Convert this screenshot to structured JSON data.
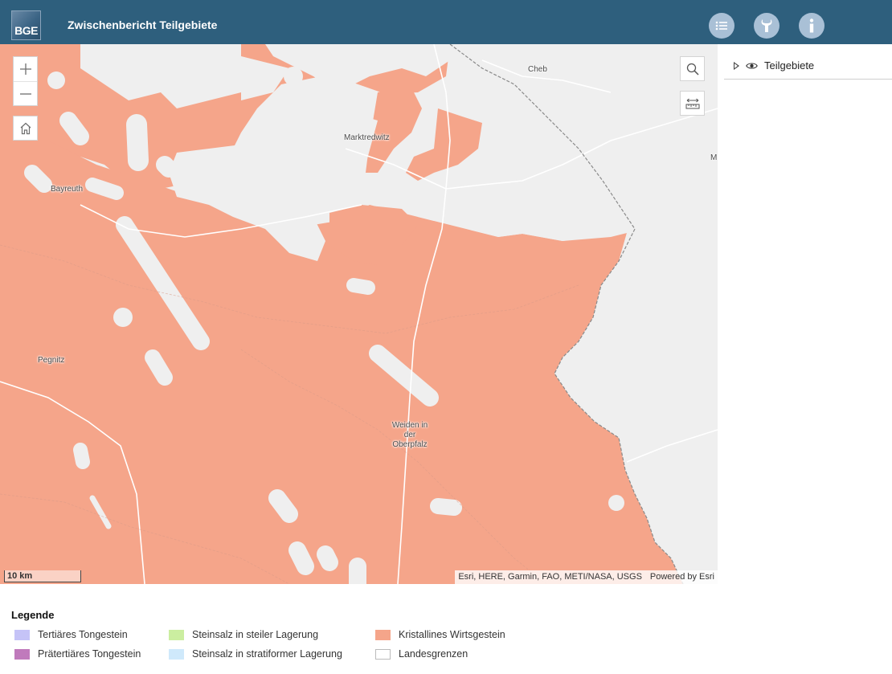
{
  "header": {
    "logo_text": "BGE",
    "title": "Zwischenbericht Teilgebiete",
    "buttons": [
      {
        "icon": "list-icon"
      },
      {
        "icon": "wrench-icon"
      },
      {
        "icon": "info-icon"
      }
    ]
  },
  "map": {
    "cities": [
      "Cheb",
      "Marktredwitz",
      "Bayreuth",
      "Pegnitz",
      "Weiden in der Oberpfalz",
      "M"
    ],
    "scale_label": "10 km",
    "attribution": "Esri, HERE, Garmin, FAO, METI/NASA, USGS",
    "powered_by": "Powered by Esri",
    "colors": {
      "crystalline": "#f5a58a",
      "basemap": "#efefef"
    }
  },
  "layer_panel": {
    "layer_name": "Teilgebiete"
  },
  "legend": {
    "title": "Legende",
    "items": [
      {
        "label": "Tertiäres Tongestein",
        "color": "#c5c3f7"
      },
      {
        "label": "Prätertiäres Tongestein",
        "color": "#c07abc"
      },
      {
        "label": "Steinsalz in steiler Lagerung",
        "color": "#cbeea0"
      },
      {
        "label": "Steinsalz in stratiformer Lagerung",
        "color": "#cfe9fb"
      },
      {
        "label": "Kristallines Wirtsgestein",
        "color": "#f5a58a"
      },
      {
        "label": "Landesgrenzen",
        "color": "#ffffff"
      }
    ]
  }
}
